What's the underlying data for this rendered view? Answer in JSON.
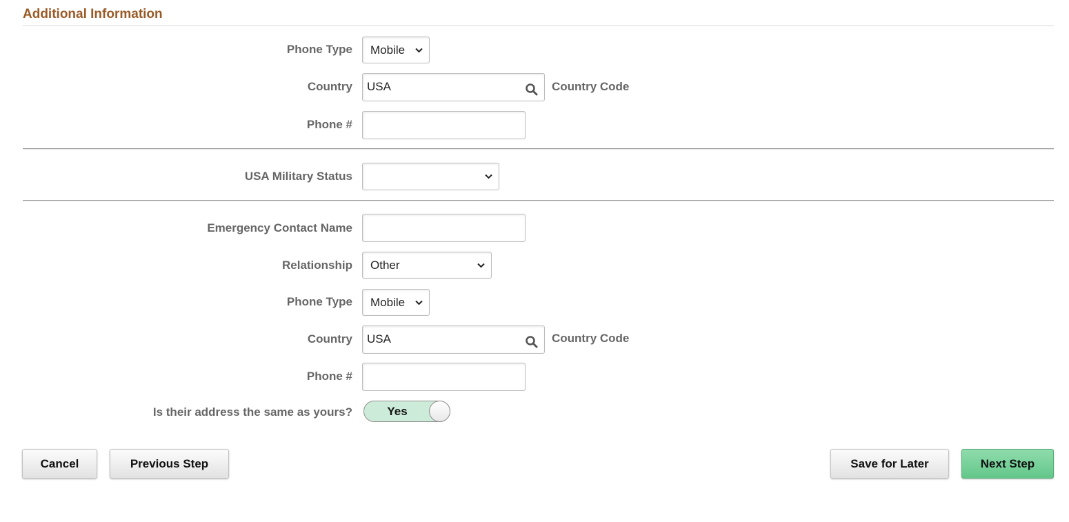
{
  "section": {
    "title": "Additional Information"
  },
  "phone": {
    "phone_type_label": "Phone Type",
    "phone_type_value": "Mobile",
    "country_label": "Country",
    "country_value": "USA",
    "country_code_label": "Country Code",
    "phone_number_label": "Phone #",
    "phone_number_value": ""
  },
  "military": {
    "label": "USA Military Status",
    "value": ""
  },
  "emergency": {
    "contact_name_label": "Emergency Contact Name",
    "contact_name_value": "",
    "relationship_label": "Relationship",
    "relationship_value": "Other",
    "phone_type_label": "Phone Type",
    "phone_type_value": "Mobile",
    "country_label": "Country",
    "country_value": "USA",
    "country_code_label": "Country Code",
    "phone_number_label": "Phone #",
    "phone_number_value": "",
    "same_address_label": "Is their address the same as yours?",
    "same_address_value": "Yes"
  },
  "buttons": {
    "cancel": "Cancel",
    "previous": "Previous Step",
    "save_later": "Save for Later",
    "next": "Next Step"
  },
  "colors": {
    "section_title": "#9a5a25",
    "toggle_on": "#cdebd9",
    "primary_button": "#63c78a"
  }
}
